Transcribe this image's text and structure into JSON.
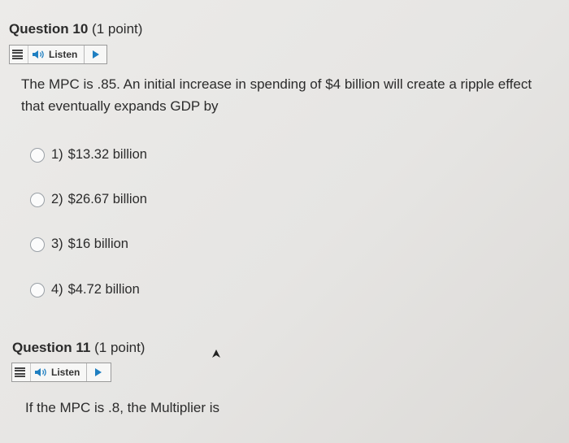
{
  "q10": {
    "title": "Question 10",
    "points": "(1 point)",
    "listen_label": "Listen",
    "text_line1": "The MPC is .85. An initial increase in spending of $4 billion will create a ripple effect",
    "text_line2": "that eventually expands GDP by",
    "options": [
      {
        "num": "1)",
        "label": "$13.32 billion"
      },
      {
        "num": "2)",
        "label": "$26.67 billion"
      },
      {
        "num": "3)",
        "label": "$16 billion"
      },
      {
        "num": "4)",
        "label": "$4.72 billion"
      }
    ]
  },
  "q11": {
    "title": "Question 11",
    "points": "(1 point)",
    "listen_label": "Listen",
    "text": "If the MPC is .8, the Multiplier is"
  },
  "colors": {
    "accent": "#1f7fc1",
    "text": "#2b2b2b"
  },
  "icons": {
    "menu": "menu-icon",
    "speaker": "speaker-icon",
    "play": "play-icon",
    "cursor": "cursor-arrow-icon"
  }
}
